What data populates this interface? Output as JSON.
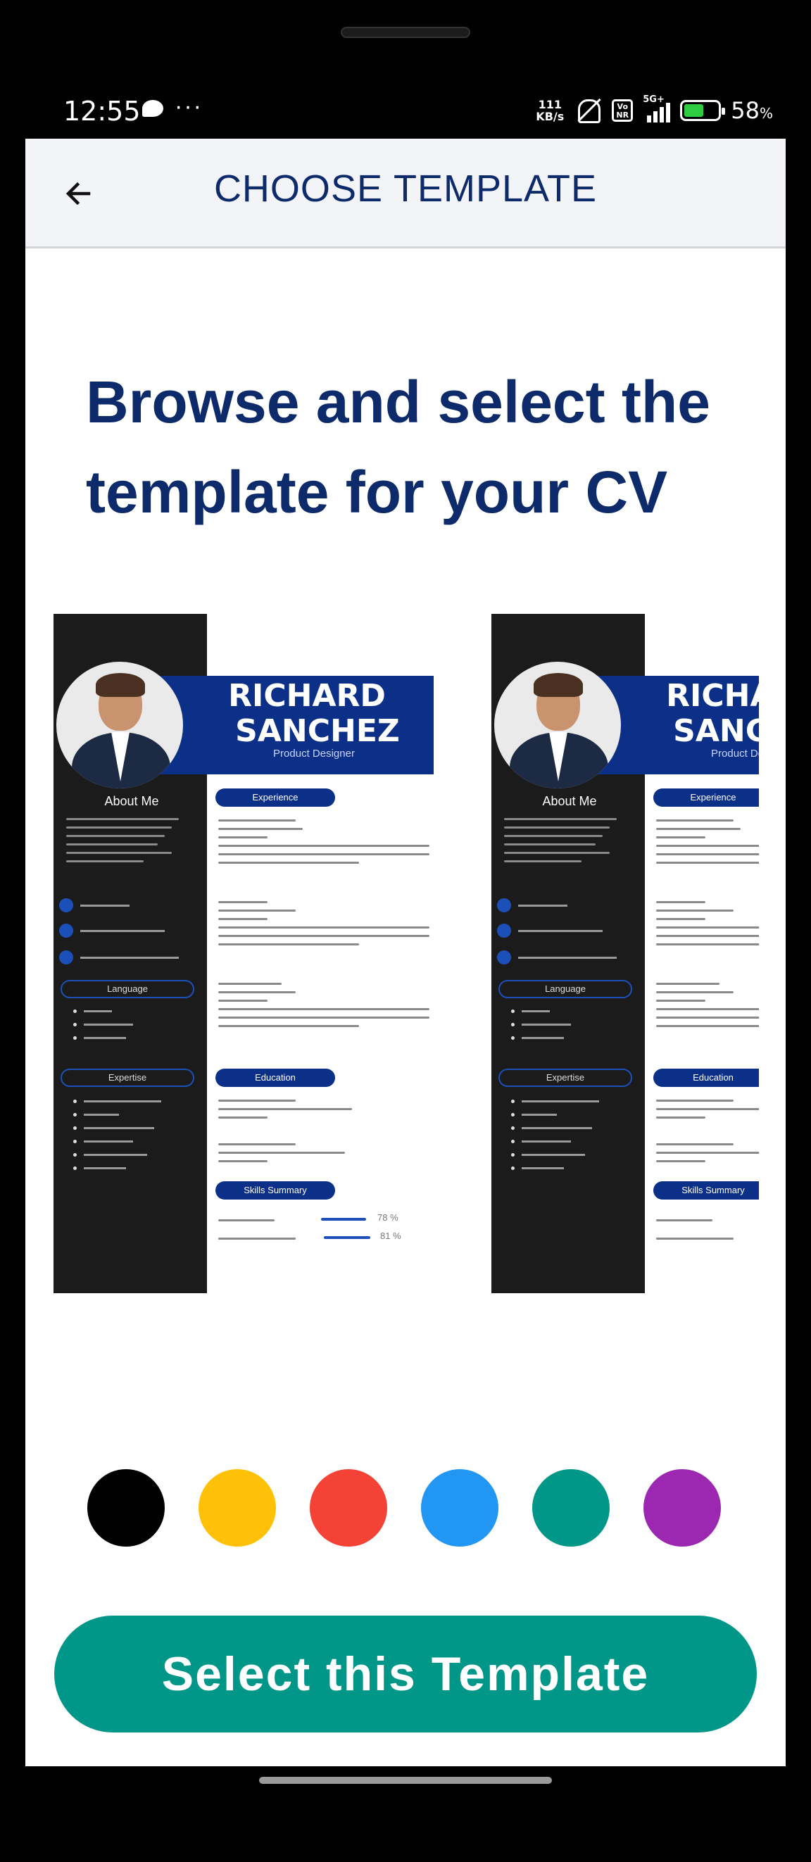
{
  "status_bar": {
    "time": "12:55",
    "network_speed_value": "111",
    "network_speed_unit": "KB/s",
    "volte_label": "Vo NR",
    "network_type": "5G+",
    "battery_percent": "58",
    "battery_percent_sign": "%",
    "battery_level": 0.58
  },
  "app_bar": {
    "title": "CHOOSE TEMPLATE",
    "back_icon": "arrow-left-icon"
  },
  "headline": "Browse and select the template for your CV",
  "templates": [
    {
      "name_line1": "RICHARD",
      "name_line2": "SANCHEZ",
      "role": "Product Designer",
      "about_title": "About Me",
      "sections": {
        "experience": "Experience",
        "education": "Education",
        "skills": "Skills Summary",
        "language": "Language",
        "expertise": "Expertise"
      },
      "skill_percents": [
        "78 %",
        "81 %"
      ]
    },
    {
      "name_line1": "RICHARD",
      "name_line2": "SANCHEZ",
      "role": "Product Designer",
      "about_title": "About Me",
      "sections": {
        "experience": "Experience",
        "education": "Education",
        "skills": "Skills Summary",
        "language": "Language",
        "expertise": "Expertise"
      }
    }
  ],
  "color_options": [
    {
      "name": "black",
      "hex": "#000000"
    },
    {
      "name": "amber",
      "hex": "#FFC107"
    },
    {
      "name": "red",
      "hex": "#F44336"
    },
    {
      "name": "blue",
      "hex": "#2196F3"
    },
    {
      "name": "teal",
      "hex": "#009688"
    },
    {
      "name": "purple",
      "hex": "#9C27B0"
    }
  ],
  "primary_button": {
    "label": "Select this Template",
    "color": "#009688"
  },
  "colors": {
    "title_text": "#0D2A6B",
    "app_bar_bg": "#F3F4F8"
  }
}
